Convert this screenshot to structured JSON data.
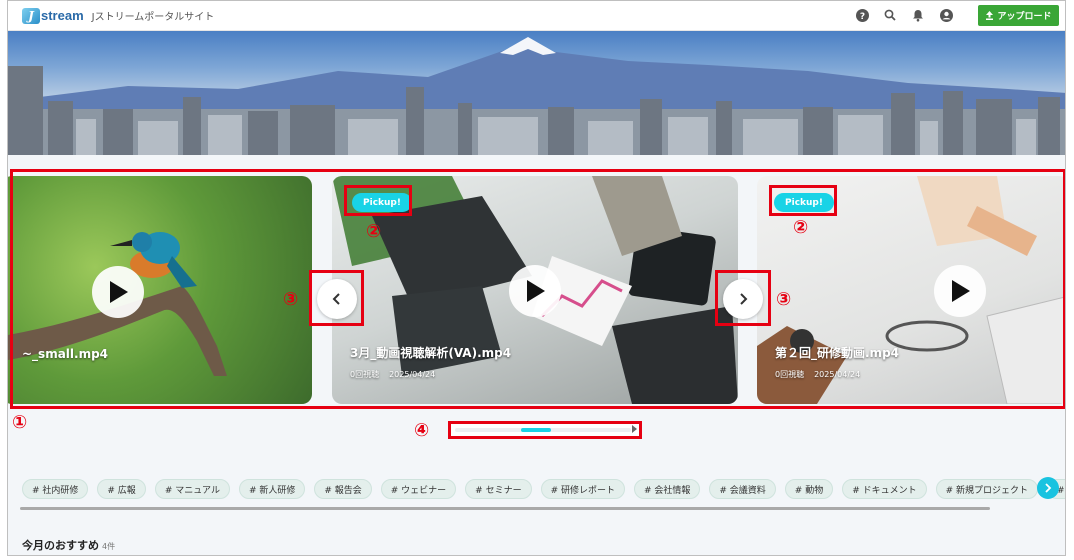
{
  "header": {
    "logo_letter": "J",
    "logo_text": "stream",
    "site_name": "Jストリームポータルサイト",
    "icons": [
      "help-icon",
      "search-icon",
      "bell-icon",
      "account-icon"
    ],
    "upload_label": "アップロード",
    "upload_color": "#3aa636"
  },
  "carousel": {
    "cards": [
      {
        "title": "~_small.mp4",
        "views": "",
        "date": ""
      },
      {
        "pickup": "Pickup!",
        "title": "3月_動画視聴解析(VA).mp4",
        "views": "0回視聴",
        "date": "2025/04/24"
      },
      {
        "pickup": "Pickup!",
        "title": "第２回_研修動画.mp4",
        "views": "0回視聴",
        "date": "2025/04/24"
      }
    ],
    "prev_icon": "chevron-left-icon",
    "next_icon": "chevron-right-icon"
  },
  "annotations": {
    "m1": "①",
    "m2": "②",
    "m3": "③",
    "m4": "④",
    "highlight_color": "#e60012"
  },
  "tags": [
    "# 社内研修",
    "# 広報",
    "# マニュアル",
    "# 新人研修",
    "# 報告会",
    "# ウェビナー",
    "# セミナー",
    "# 研修レポート",
    "# 会社情報",
    "# 会議資料",
    "# 動物",
    "# ドキュメント",
    "# 新規プロジェクト",
    "# 社内プ"
  ],
  "section": {
    "title": "今月のおすすめ",
    "count": "4件"
  },
  "accent_color": "#19d3e6"
}
